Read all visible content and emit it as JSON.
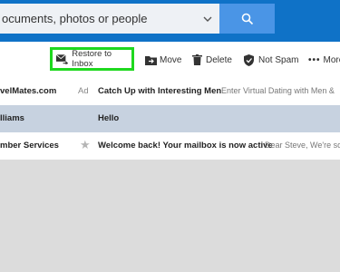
{
  "search": {
    "placeholder": "ocuments, photos or people",
    "dropdown_icon": "chevron-down-icon",
    "search_icon": "search-icon"
  },
  "toolbar": {
    "restore_label": "Restore to Inbox",
    "move_label": "Move",
    "delete_label": "Delete",
    "notspam_label": "Not Spam",
    "more_label": "More"
  },
  "messages": [
    {
      "sender": "velMates.com",
      "tag": "Ad",
      "subject": "Catch Up with Interesting Men",
      "preview": "Enter Virtual Dating with Men &"
    },
    {
      "sender": "lliams",
      "subject": "Hello",
      "preview": ""
    },
    {
      "sender": "mber Services",
      "subject": "Welcome back! Your mailbox is now active",
      "preview": "Dear Steve, We're so"
    }
  ],
  "colors": {
    "header": "#0f72c7",
    "search_button": "#4a95e6",
    "highlight": "#1fd81f",
    "selected_row": "#c7d2e0"
  }
}
